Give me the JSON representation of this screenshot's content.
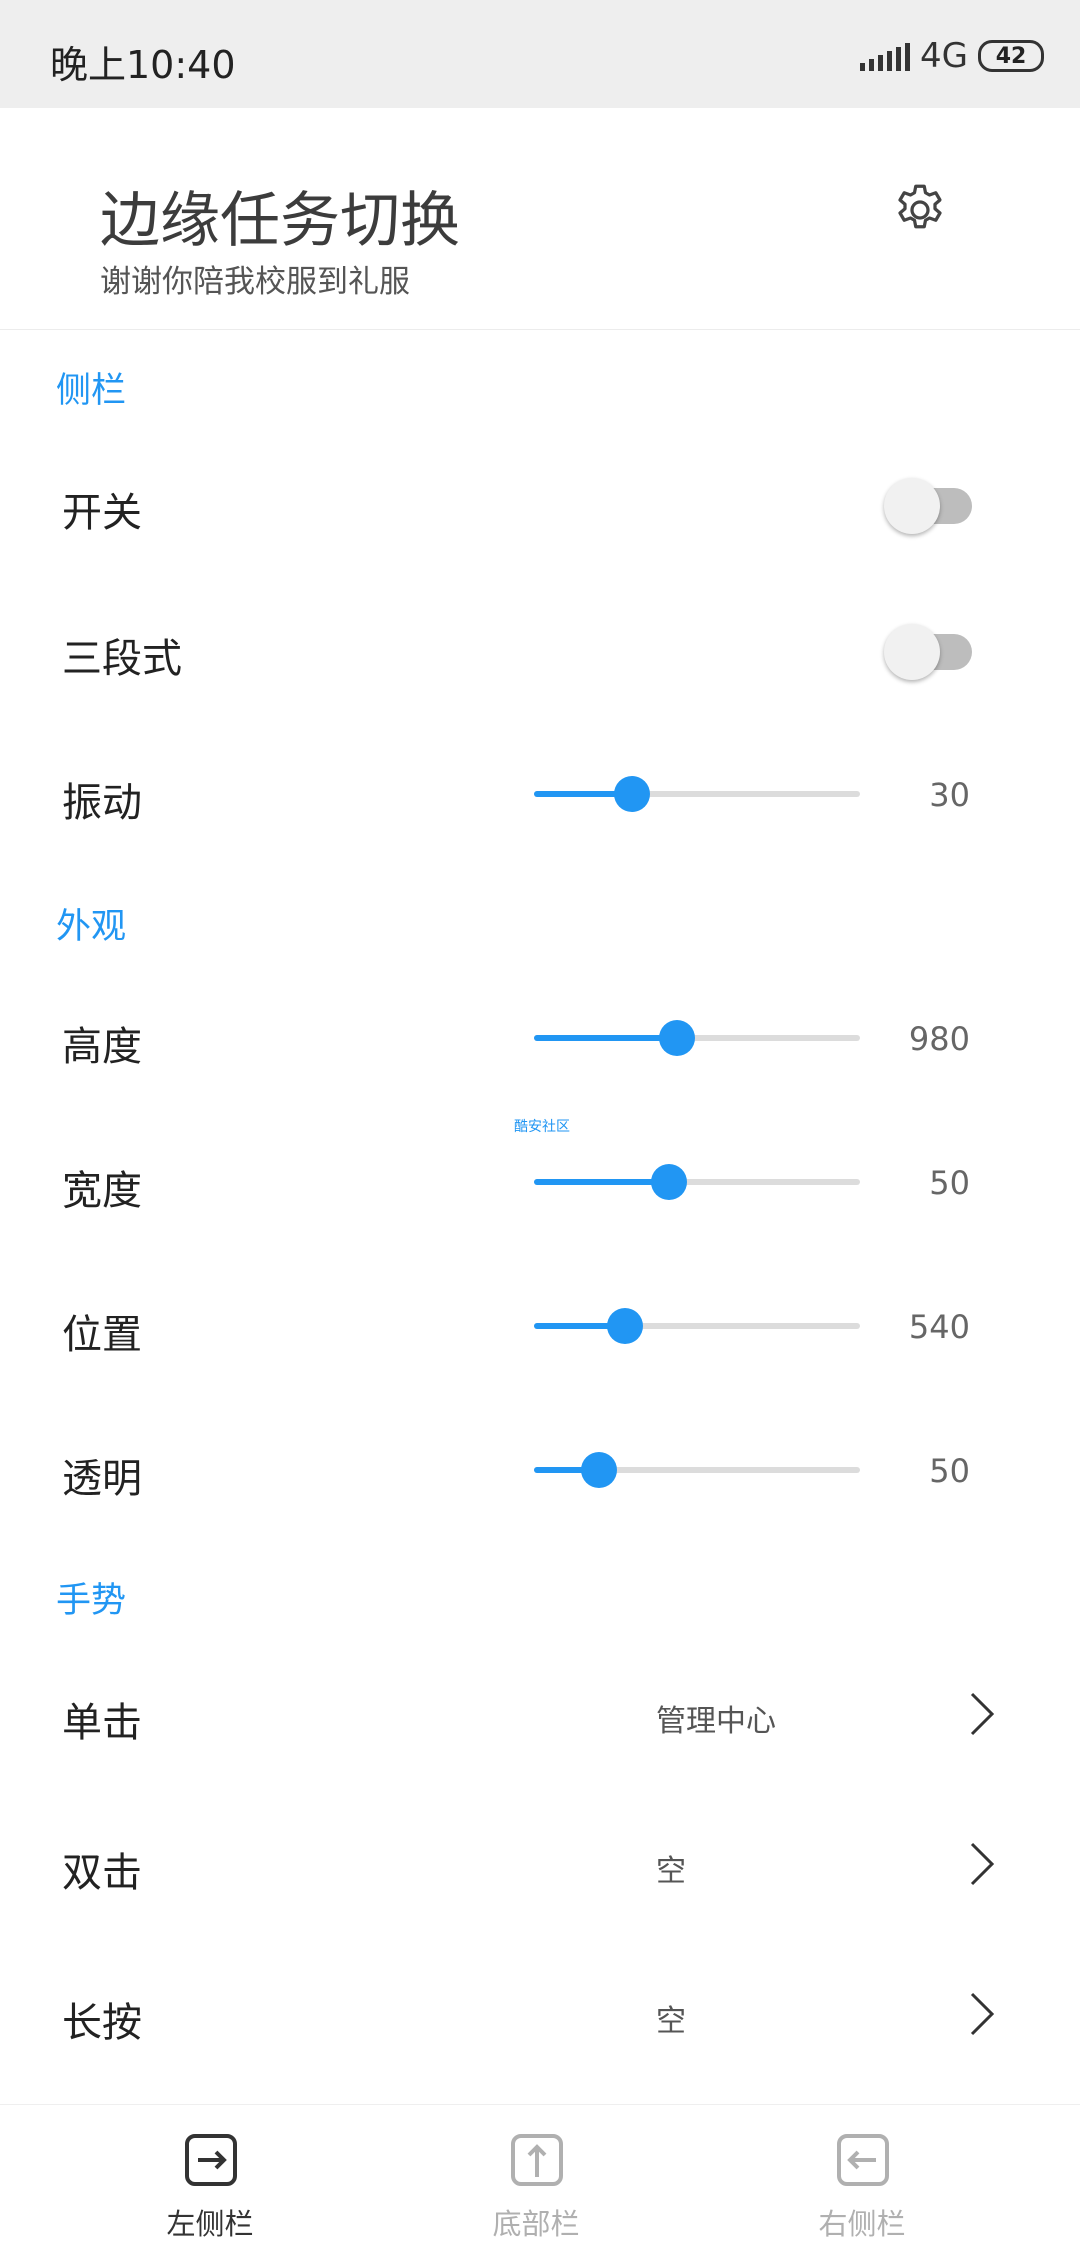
{
  "status_bar": {
    "time": "晚上10:40",
    "network": "4G",
    "battery": "42"
  },
  "header": {
    "title": "边缘任务切换",
    "subtitle": "谢谢你陪我校服到礼服",
    "settings_icon": "gear-icon"
  },
  "sections": {
    "sidebar": {
      "title": "侧栏",
      "switch_label": "开关",
      "switch_on": false,
      "three_stage_label": "三段式",
      "three_stage_on": false,
      "vibration_label": "振动",
      "vibration_value": "30",
      "vibration_fraction": 0.3
    },
    "appearance": {
      "title": "外观",
      "height_label": "高度",
      "height_value": "980",
      "height_fraction": 0.44,
      "width_label": "宽度",
      "width_value": "50",
      "width_fraction": 0.415,
      "position_label": "位置",
      "position_value": "540",
      "position_fraction": 0.28,
      "opacity_label": "透明",
      "opacity_value": "50",
      "opacity_fraction": 0.2,
      "watermark": "酷安社区"
    },
    "gestures": {
      "title": "手势",
      "single_label": "单击",
      "single_value": "管理中心",
      "double_label": "双击",
      "double_value": "空",
      "long_label": "长按",
      "long_value": "空"
    }
  },
  "bottom_nav": {
    "items": [
      {
        "label": "左侧栏",
        "icon": "left-sidebar-icon",
        "active": true
      },
      {
        "label": "底部栏",
        "icon": "bottom-bar-icon",
        "active": false
      },
      {
        "label": "右侧栏",
        "icon": "right-sidebar-icon",
        "active": false
      }
    ]
  },
  "colors": {
    "accent": "#2196f3",
    "active_nav": "#333333",
    "inactive_nav": "#b0b0b0"
  }
}
